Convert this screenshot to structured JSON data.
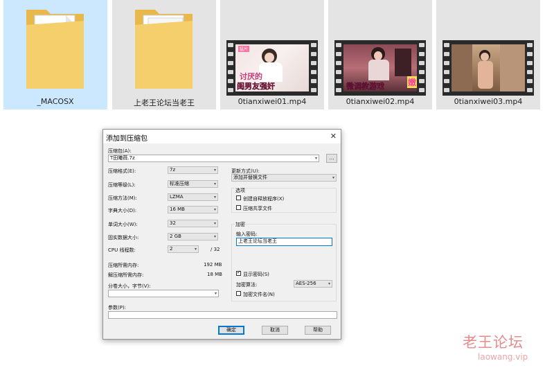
{
  "files": [
    {
      "name": "_MACOSX",
      "kind": "folder",
      "selected": true
    },
    {
      "name": "上老王论坛当老王",
      "kind": "folder",
      "selected": false
    },
    {
      "name": "0tianxiwei01.mp4",
      "kind": "video",
      "selected": false,
      "caption_top": "讨厌的",
      "caption_bottom": "闺男友强奸",
      "corner_tag": "猛片"
    },
    {
      "name": "0tianxiwei02.mp4",
      "kind": "video",
      "selected": false,
      "caption_bottom": "微调教游戏",
      "corner_tag": "嫩"
    },
    {
      "name": "0tianxiwei03.mp4",
      "kind": "video",
      "selected": false
    }
  ],
  "dialog": {
    "title": "添加到压缩包",
    "archive_label": "压缩包(A):",
    "archive_value": "T田曦薇.7z",
    "browse_label": "...",
    "format_label": "压缩格式(E):",
    "format_value": "7z",
    "level_label": "压缩等级(L):",
    "level_value": "标准压缩",
    "method_label": "压缩方法(M):",
    "method_value": "LZMA",
    "dict_label": "字典大小(D):",
    "dict_value": "16 MB",
    "word_label": "单词大小(W):",
    "word_value": "32",
    "solid_label": "固实数据大小:",
    "solid_value": "2 GB",
    "cpu_label": "CPU 线程数:",
    "cpu_value": "2",
    "cpu_total": "/ 32",
    "mem_comp_label": "压缩所需内存:",
    "mem_comp_value": "192 MB",
    "mem_decomp_label": "解压缩所需内存:",
    "mem_decomp_value": "18 MB",
    "split_label": "分卷大小，字节(V):",
    "split_value": "",
    "params_label": "参数(P):",
    "params_value": "",
    "update_label": "更新方式(U):",
    "update_value": "添加并替换文件",
    "options_label": "选项",
    "sfx_label": "创建自释放程序(X)",
    "sfx_checked": false,
    "shared_label": "压缩共享文件",
    "shared_checked": false,
    "encrypt_label": "加密",
    "password_label": "输入密码:",
    "password_value": "上老王论坛当老王",
    "show_pw_label": "显示密码(S)",
    "show_pw_checked": true,
    "algo_label": "加密算法:",
    "algo_value": "AES-256",
    "encnames_label": "加密文件名(N)",
    "encnames_checked": false,
    "ok_label": "确定",
    "cancel_label": "取消",
    "help_label": "帮助",
    "close_glyph": "✕"
  },
  "watermark": {
    "text": "老王论坛",
    "domain": "laowang.vip"
  },
  "colors": {
    "selected_tile": "#cce8ff",
    "tile": "#e4e4e4",
    "folder": "#f5cf6b",
    "accent": "#0078d7"
  }
}
